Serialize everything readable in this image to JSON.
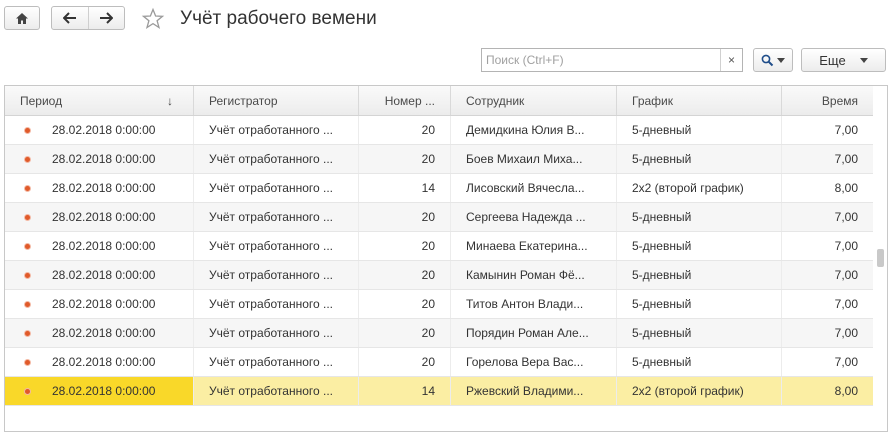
{
  "toolbar": {
    "home_icon": "home-icon",
    "back_icon": "arrow-left-icon",
    "forward_icon": "arrow-right-icon",
    "favorite_icon": "star-outline-icon",
    "title": "Учёт рабочего вемени"
  },
  "search": {
    "placeholder": "Поиск (Ctrl+F)",
    "clear_label": "×",
    "search_icon": "magnifier-icon"
  },
  "more_button": {
    "label": "Еще"
  },
  "table": {
    "columns": [
      "Период",
      "Регистратор",
      "Номер ...",
      "Сотрудник",
      "График",
      "Время"
    ],
    "sort_indicator": "↓",
    "rows": [
      {
        "period": "28.02.2018 0:00:00",
        "registrar": "Учёт отработанного ...",
        "number": "20",
        "employee": "Демидкина Юлия В...",
        "schedule": "5-дневный",
        "time": "7,00"
      },
      {
        "period": "28.02.2018 0:00:00",
        "registrar": "Учёт отработанного ...",
        "number": "20",
        "employee": "Боев Михаил Миха...",
        "schedule": "5-дневный",
        "time": "7,00"
      },
      {
        "period": "28.02.2018 0:00:00",
        "registrar": "Учёт отработанного ...",
        "number": "14",
        "employee": "Лисовский Вячесла...",
        "schedule": "2x2 (второй график)",
        "time": "8,00"
      },
      {
        "period": "28.02.2018 0:00:00",
        "registrar": "Учёт отработанного ...",
        "number": "20",
        "employee": "Сергеева Надежда ...",
        "schedule": "5-дневный",
        "time": "7,00"
      },
      {
        "period": "28.02.2018 0:00:00",
        "registrar": "Учёт отработанного ...",
        "number": "20",
        "employee": "Минаева Екатерина...",
        "schedule": "5-дневный",
        "time": "7,00"
      },
      {
        "period": "28.02.2018 0:00:00",
        "registrar": "Учёт отработанного ...",
        "number": "20",
        "employee": "Камынин Роман Фё...",
        "schedule": "5-дневный",
        "time": "7,00"
      },
      {
        "period": "28.02.2018 0:00:00",
        "registrar": "Учёт отработанного ...",
        "number": "20",
        "employee": "Титов Антон Влади...",
        "schedule": "5-дневный",
        "time": "7,00"
      },
      {
        "period": "28.02.2018 0:00:00",
        "registrar": "Учёт отработанного ...",
        "number": "20",
        "employee": "Порядин Роман Але...",
        "schedule": "5-дневный",
        "time": "7,00"
      },
      {
        "period": "28.02.2018 0:00:00",
        "registrar": "Учёт отработанного ...",
        "number": "20",
        "employee": "Горелова Вера Вас...",
        "schedule": "5-дневный",
        "time": "7,00"
      },
      {
        "period": "28.02.2018 0:00:00",
        "registrar": "Учёт отработанного ...",
        "number": "14",
        "employee": "Ржевский Владими...",
        "schedule": "2x2 (второй график)",
        "time": "8,00"
      }
    ],
    "selected_row": 9,
    "selected_row_color": "#fbeea3",
    "selected_cell_color": "#f9d829",
    "row_marker_color": "#e05a2a"
  }
}
